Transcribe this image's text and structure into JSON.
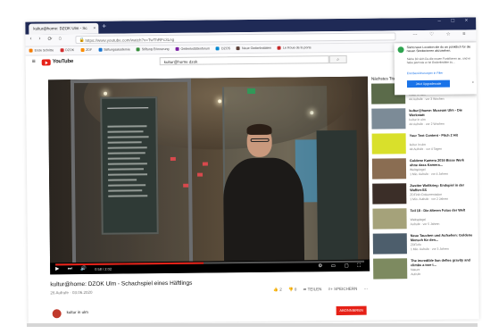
{
  "browser": {
    "tab_title": "kultur@home: DZOK Ulm - Sc",
    "tab_close": "×",
    "new_tab": "+",
    "window_controls": "– □ ×",
    "nav": {
      "back": "‹",
      "forward": "›",
      "reload": "⟳",
      "home": "⌂"
    },
    "url": "https://www.youtube.com/watch?v=TwThRFc3Lng",
    "right_icons": "⋯ ♡ ☆ ≡",
    "bookmarks": [
      {
        "label": "Erste Schritte",
        "color": "#f57c00"
      },
      {
        "label": "DZOK",
        "color": "#d32f2f"
      },
      {
        "label": "ZDF",
        "color": "#fb8c00"
      },
      {
        "label": "Stiftungsakademie",
        "color": "#1976d2"
      },
      {
        "label": "Stiftung Erinnerung",
        "color": "#388e3c"
      },
      {
        "label": "Gedenkstättenforum",
        "color": "#7b1fa2"
      },
      {
        "label": "DZOS",
        "color": "#0288d1"
      },
      {
        "label": "Neue Gedenkstätten",
        "color": "#5d4037"
      },
      {
        "label": "Le Roue de la porte",
        "color": "#c62828"
      }
    ]
  },
  "youtube": {
    "menu_icon": "≡",
    "logo_text": "YouTube",
    "search_value": "kultur@home dzok",
    "search_icon": "⌕",
    "player": {
      "progress_percent": 48,
      "controls_left": "▶ ⏭ 🔊",
      "time": "0:58 / 2:02",
      "controls_right": "⚙ ▭ ▢ ⛶"
    },
    "video_title": "kultur@home: DZOK Ulm - Schachspiel eines Häftlings",
    "video_meta": "26 Aufrufe · 03.06.2020",
    "actions": [
      "👍 2",
      "👎 0",
      "➦ TEILEN",
      "≡+ SPEICHERN",
      "⋯"
    ],
    "channel_name": "kultur in ulm",
    "subscribe_label": "ABONNIEREN",
    "up_next_label": "Nächstes Titel",
    "autoplay_label": "AUTOPLAY",
    "recommendations": [
      {
        "title": "kultur@home: DZOK Ulm - ...",
        "channel": "kultur in ulm",
        "views": "44 Aufrufe · vor 3 Wochen",
        "thumb": "#5b6b4a"
      },
      {
        "title": "kultur@home: Museum Ulm - Die Werkstatt",
        "channel": "kultur in ulm",
        "views": "44 Aufrufe · vor 2 Wochen",
        "thumb": "#7c8b97"
      },
      {
        "title": "Your Text Content - Pitch 2 Hit",
        "channel": "kultur in ulm",
        "views": "44 Aufrufe · vor 4 Tagen",
        "thumb": "#d9e02b"
      },
      {
        "title": "Goldene Kamera 2016 Bisse Werk ohne dass Kamera...",
        "channel": "Weltspiegel",
        "views": "1 Mio. Aufrufe · vor 4 Jahren",
        "thumb": "#8a6d52"
      },
      {
        "title": "Zweiter Weltkrieg: Endspiel in der Waffen-SS",
        "channel": "ZDFinfo Dokumentation",
        "views": "1 Mio. Aufrufe · vor 2 Jahren",
        "thumb": "#3b2e28"
      },
      {
        "title": "Teil 18 - Die älteren Fotos der Welt",
        "channel": "Weltspiegel",
        "views": "Aufrufe · vor 5 Jahren",
        "thumb": "#a5a27a"
      },
      {
        "title": "Neue Tauchen und Aufsehen: Goldene Mensch für den...",
        "channel": "ZDFinfo",
        "views": "1 Mio. Aufrufe · vor 3 Jahren",
        "thumb": "#4d5e6c"
      },
      {
        "title": "The incredible lion defies gravity and climbs a tree t...",
        "channel": "Nature",
        "views": "Aufrufe",
        "thumb": "#7d8a60"
      }
    ]
  },
  "popup": {
    "heading": "Sieht neue Location die du an pünktlich für die neuen Streiterinnen abzusehen.",
    "body": "Siehe Dir sich Du die neuen Funktionen an, und er habe jetzt wie er ist Gedenkstätte zu...",
    "link": "Erst Bereicherungen in Filter",
    "button_label": "Jetzt Upgradecode",
    "close_label": "×"
  }
}
